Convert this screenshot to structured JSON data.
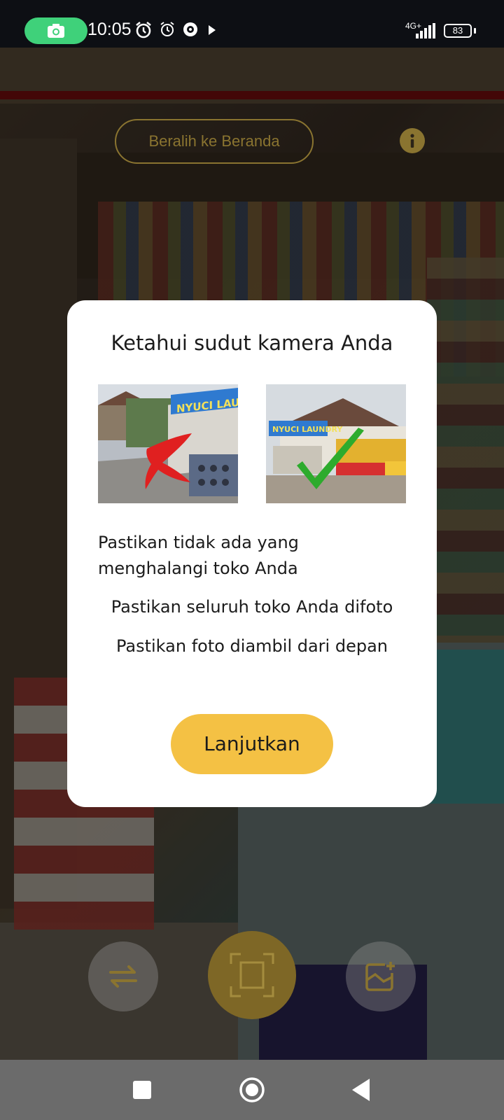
{
  "status_bar": {
    "time": "10:05",
    "network": "4G+",
    "battery": "83",
    "icons": [
      "screen-record-icon",
      "alarm-icon",
      "alarm-clock-icon",
      "app-notification-icon",
      "play-icon",
      "signal-icon"
    ]
  },
  "camera": {
    "home_button_label": "Beralih ke Beranda",
    "info_icon": "info-icon",
    "controls": [
      "switch-camera-icon",
      "shutter-frame-icon",
      "gallery-add-icon"
    ]
  },
  "dialog": {
    "title": "Ketahui sudut kamera Anda",
    "example_bad_sign": "NYUCI LAU",
    "example_good_sign": "NYUCI LAUNDRY",
    "tips": [
      "Pastikan tidak ada yang menghalangi toko Anda",
      "Pastikan seluruh toko Anda difoto",
      "Pastikan foto diambil dari depan"
    ],
    "continue_label": "Lanjutkan"
  },
  "colors": {
    "accent": "#F4C144",
    "dialog_bg": "#FFFFFF",
    "status_pill": "#3FD17A",
    "nav_bar": "#6B6B6B"
  },
  "nav_bar": {
    "icons": [
      "recent-apps-icon",
      "home-icon",
      "back-icon"
    ]
  }
}
